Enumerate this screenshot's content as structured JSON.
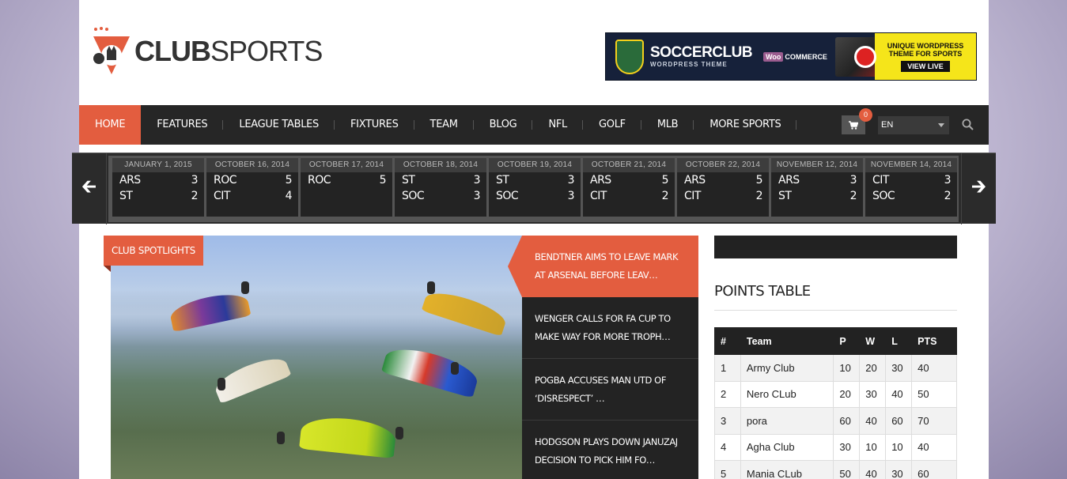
{
  "brand": {
    "name_bold": "CLUB",
    "name_light": "SPORTS"
  },
  "ad": {
    "brand": "SOCCERCLUB",
    "subtitle": "WORDPRESS THEME",
    "woo_a": "Woo",
    "woo_b": "COMMERCE",
    "tagline": "UNIQUE WORDPRESS THEME FOR SPORTS",
    "cta": "VIEW LIVE"
  },
  "nav": {
    "items": [
      "HOME",
      "FEATURES",
      "LEAGUE TABLES",
      "FIXTURES",
      "TEAM",
      "BLOG",
      "NFL",
      "GOLF",
      "MLB",
      "MORE SPORTS"
    ],
    "active_index": 0,
    "cart_count": "0",
    "language": "EN"
  },
  "ticker": {
    "matches": [
      {
        "date": "JANUARY 1, 2015",
        "home": "ARS",
        "home_score": "3",
        "away": "ST",
        "away_score": "2"
      },
      {
        "date": "OCTOBER 16, 2014",
        "home": "ROC",
        "home_score": "5",
        "away": "CIT",
        "away_score": "4"
      },
      {
        "date": "OCTOBER 17, 2014",
        "home": "ROC",
        "home_score": "5",
        "away": "",
        "away_score": ""
      },
      {
        "date": "OCTOBER 18, 2014",
        "home": "ST",
        "home_score": "3",
        "away": "SOC",
        "away_score": "3"
      },
      {
        "date": "OCTOBER 19, 2014",
        "home": "ST",
        "home_score": "3",
        "away": "SOC",
        "away_score": "3"
      },
      {
        "date": "OCTOBER 21, 2014",
        "home": "ARS",
        "home_score": "5",
        "away": "CIT",
        "away_score": "2"
      },
      {
        "date": "OCTOBER 22, 2014",
        "home": "ARS",
        "home_score": "5",
        "away": "CIT",
        "away_score": "2"
      },
      {
        "date": "NOVEMBER 12, 2014",
        "home": "ARS",
        "home_score": "3",
        "away": "ST",
        "away_score": "2"
      },
      {
        "date": "NOVEMBER 14, 2014",
        "home": "CIT",
        "home_score": "3",
        "away": "SOC",
        "away_score": "2"
      }
    ]
  },
  "hero": {
    "badge": "CLUB SPOTLIGHTS"
  },
  "news": [
    {
      "title": "BENDTNER AIMS TO LEAVE MARK AT ARSENAL BEFORE LEAV…",
      "active": true
    },
    {
      "title": "WENGER CALLS FOR FA CUP TO MAKE WAY FOR MORE TROPH…",
      "active": false
    },
    {
      "title": "POGBA ACCUSES MAN UTD OF ‘DISRESPECT’ …",
      "active": false
    },
    {
      "title": "HODGSON PLAYS DOWN JANUZAJ DECISION TO PICK HIM FO…",
      "active": false
    }
  ],
  "points_table": {
    "title": "POINTS TABLE",
    "headers": [
      "#",
      "Team",
      "P",
      "W",
      "L",
      "PTS"
    ],
    "rows": [
      [
        "1",
        "Army Club",
        "10",
        "20",
        "30",
        "40"
      ],
      [
        "2",
        "Nero CLub",
        "20",
        "30",
        "40",
        "50"
      ],
      [
        "3",
        "pora",
        "60",
        "40",
        "60",
        "70"
      ],
      [
        "4",
        "Agha Club",
        "30",
        "10",
        "10",
        "40"
      ],
      [
        "5",
        "Mania CLub",
        "50",
        "40",
        "30",
        "60"
      ]
    ]
  },
  "colors": {
    "accent": "#e35d3f",
    "dark": "#262626"
  }
}
